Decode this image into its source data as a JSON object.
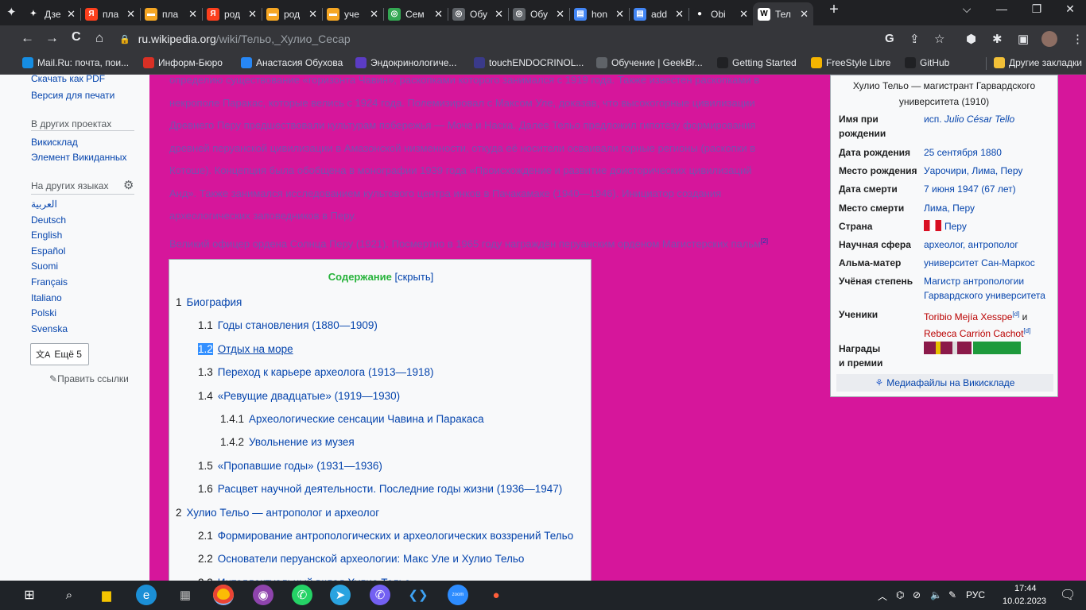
{
  "tabs": [
    {
      "label": "Дзе",
      "fav": "✦",
      "favColor": "#202124"
    },
    {
      "label": "пла",
      "fav": "Я",
      "favColor": "#fc3f1d"
    },
    {
      "label": "пла",
      "fav": "▬",
      "favColor": "#f5a623"
    },
    {
      "label": "род",
      "fav": "Я",
      "favColor": "#fc3f1d"
    },
    {
      "label": "род",
      "fav": "▬",
      "favColor": "#f5a623"
    },
    {
      "label": "уче",
      "fav": "▬",
      "favColor": "#f5a623"
    },
    {
      "label": "Сем",
      "fav": "◎",
      "favColor": "#34a853"
    },
    {
      "label": "Обу",
      "fav": "◎",
      "favColor": "#5f6368"
    },
    {
      "label": "Обу",
      "fav": "◎",
      "favColor": "#5f6368"
    },
    {
      "label": "hon",
      "fav": "▤",
      "favColor": "#4285f4"
    },
    {
      "label": "add",
      "fav": "▤",
      "favColor": "#4285f4"
    },
    {
      "label": "Obi",
      "fav": "●",
      "favColor": "#202124"
    },
    {
      "label": "Тел",
      "fav": "W",
      "favColor": "#ffffff"
    }
  ],
  "window": {
    "new_tab": "+",
    "minimize": "—",
    "maximize": "❐",
    "close": "✕",
    "tab_search": "⌵"
  },
  "toolbar": {
    "back": "←",
    "forward": "→",
    "reload": "C",
    "home": "⌂",
    "domain": "ru.wikipedia.org",
    "path": "/wiki/Тельо,_Хулио_Сесар"
  },
  "bookmarks": [
    {
      "label": "Mail.Ru: почта, пои...",
      "color": "#168de2"
    },
    {
      "label": "Информ-Бюро",
      "color": "#d93025"
    },
    {
      "label": "Анастасия Обухова",
      "color": "#2787f5"
    },
    {
      "label": "Эндокринологиче...",
      "color": "#5b3cc4"
    },
    {
      "label": "touchENDOCRINOL...",
      "color": "#3a3a8a"
    },
    {
      "label": "Обучение | GeekBr...",
      "color": "#5f6368"
    },
    {
      "label": "Getting Started",
      "color": "#202124"
    },
    {
      "label": "FreeStyle Libre",
      "color": "#f5b400"
    },
    {
      "label": "GitHub",
      "color": "#202124"
    },
    {
      "label": "Другие закладки",
      "color": "#f2c037"
    }
  ],
  "sidebar": {
    "cut_top": "Скачать как PDF",
    "print": "Версия для печати",
    "other_projects": "В других проектах",
    "commons": "Викисклад",
    "wikidata": "Элемент Викиданных",
    "languages_heading": "На других языках",
    "languages": [
      "العربية",
      "Deutsch",
      "English",
      "Español",
      "Suomi",
      "Français",
      "Italiano",
      "Polski",
      "Svenska"
    ],
    "more": "Ещё 5",
    "edit_links": "Править ссылки"
  },
  "article": {
    "lines": [
      "определию существование «горизонта Чавин», раскопками которого занимался с 1919 года. Также известен раскопками в",
      "некрополе Паракас, которые велись с 1924 года. Полемизировал с Максом Уле, доказав, что высокогорные цивилизации",
      "Древнего Перу предшествовали культурам побережья — Моче и Наска. Далее Тельо предложил гипотезу формирования",
      "древней перуанской цивилизации в Амазонской низменности, откуда её носители осваивали горные регионы (раскопки в",
      "Котоше). Концепция была обобщена в монографии 1939 года «Происхождение и развитие доисторических цивилизаций",
      "Анд». Также занимался исследованием культового центра инков в Пачакамаке (1940—1946). Инициатор создания",
      "археологических заповедников в Перу."
    ],
    "award_para": "Великий офицер ордена Солнца Перу (1921). Посмертно в 1965 году награждён перуанским орденом Магистерских пальм",
    "award_ref": "[2]"
  },
  "toc": {
    "title": "Содержание",
    "toggle": "[скрыть]",
    "items": [
      {
        "n": "1",
        "label": "Биография",
        "lvl": 0
      },
      {
        "n": "1.1",
        "label": "Годы становления (1880—1909)",
        "lvl": 1
      },
      {
        "n": "1.2",
        "label": "Отдых на море",
        "lvl": 1
      },
      {
        "n": "1.3",
        "label": "Переход к карьере археолога (1913—1918)",
        "lvl": 1
      },
      {
        "n": "1.4",
        "label": "«Ревущие двадцатые» (1919—1930)",
        "lvl": 1
      },
      {
        "n": "1.4.1",
        "label": "Археологические сенсации Чавина и Паракаса",
        "lvl": 2
      },
      {
        "n": "1.4.2",
        "label": "Увольнение из музея",
        "lvl": 2
      },
      {
        "n": "1.5",
        "label": "«Пропавшие годы» (1931—1936)",
        "lvl": 1
      },
      {
        "n": "1.6",
        "label": "Расцвет научной деятельности. Последние годы жизни (1936—1947)",
        "lvl": 1
      },
      {
        "n": "2",
        "label": "Хулио Тельо — антрополог и археолог",
        "lvl": 0
      },
      {
        "n": "2.1",
        "label": "Формирование антропологических и археологических воззрений Тельо",
        "lvl": 1
      },
      {
        "n": "2.2",
        "label": "Основатели перуанской археологии: Макс Уле и Хулио Тельо",
        "lvl": 1
      },
      {
        "n": "2.3",
        "label": "Интеллектуальный вклад Хулио Тельо",
        "lvl": 1
      }
    ]
  },
  "infobox": {
    "caption1": "Хулио Тельо — магистрант Гарвардского",
    "caption2": "университета (1910)",
    "birth_name_k1": "Имя при",
    "birth_name_k2": "рождении",
    "birth_name_prefix": "исп.",
    "birth_name": "Julio César Tello",
    "birth_date_k": "Дата рождения",
    "birth_date": "25 сентября 1880",
    "birth_place_k": "Место рождения",
    "birth_place": "Уарочири, Лима, Перу",
    "death_date_k": "Дата смерти",
    "death_date": "7 июня 1947 (67 лет)",
    "death_place_k": "Место смерти",
    "death_place": "Лима, Перу",
    "country_k": "Страна",
    "country": "Перу",
    "field_k": "Научная сфера",
    "field": "археолог, антрополог",
    "alma_k": "Альма-матер",
    "alma": "университет Сан-Маркос",
    "degree_k": "Учёная степень",
    "degree1": "Магистр антропологии",
    "degree2": "Гарвардского университета",
    "students_k": "Ученики",
    "student1": "Toribio Mejía Xesspe",
    "ref_d": "[d]",
    "and": "и",
    "student2": "Rebeca Carrión Cachot",
    "awards_k1": "Награды",
    "awards_k2": "и премии",
    "media": "Медиафайлы на Викискладе",
    "ribbon1": "#8b1a4a",
    "ribbon2": "#1e9a3c"
  },
  "taskbar": {
    "lang": "РУС",
    "time": "17:44",
    "date": "10.02.2023"
  }
}
